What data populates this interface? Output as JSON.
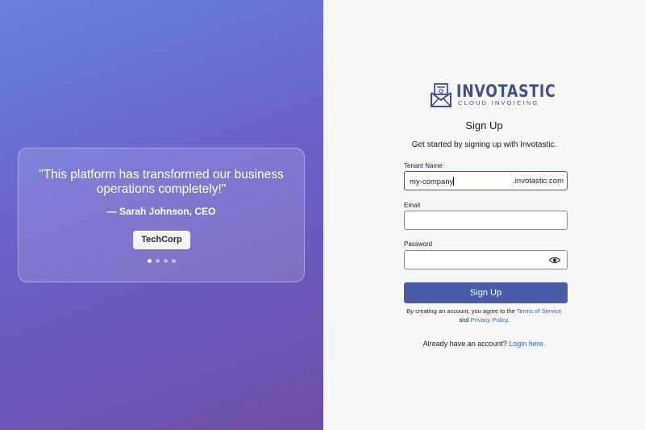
{
  "testimonial": {
    "quote": "\"This platform has transformed our business operations completely!\"",
    "author": "— Sarah Johnson, CEO",
    "company": "TechCorp",
    "dot_count": 4,
    "active_dot": 1
  },
  "brand": {
    "name": "INVOTASTIC",
    "tagline": "CLOUD INVOICING",
    "logo_icon": "envelope-invoice-icon",
    "color": "#3f4f8f"
  },
  "form": {
    "title": "Sign Up",
    "subtitle": "Get started by signing up with Invotastic.",
    "tenant": {
      "label": "Tenant Name",
      "value": "my-company",
      "suffix": ".invotastic.com"
    },
    "email": {
      "label": "Email",
      "value": ""
    },
    "password": {
      "label": "Password",
      "value": "",
      "toggle_icon": "eye-icon"
    },
    "submit_label": "Sign Up",
    "terms": {
      "prefix": "By creating an account, you agree to the",
      "terms_link": "Terms of Service",
      "and": "and",
      "privacy_link": "Privacy Policy",
      "period": "."
    },
    "login": {
      "prompt": "Already have an account?",
      "link": "Login here."
    }
  },
  "colors": {
    "accent": "#4a5ba7",
    "link": "#3a66c4",
    "gradient_start": "#6a7fe0",
    "gradient_end": "#6e4ea6"
  }
}
